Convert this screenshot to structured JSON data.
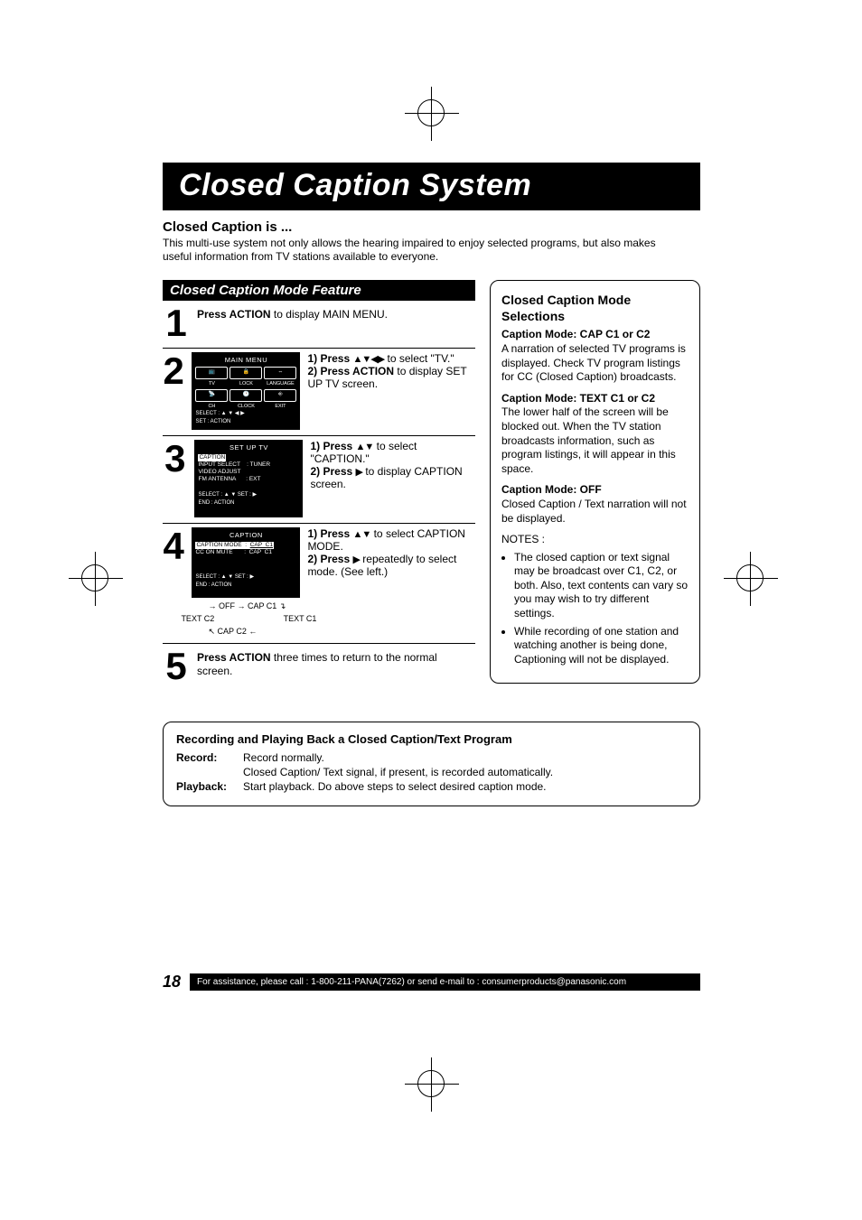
{
  "title": "Closed Caption System",
  "intro": {
    "head": "Closed Caption is ...",
    "text": "This multi-use system not only allows the hearing impaired to enjoy selected programs, but also makes useful information from TV stations available to everyone."
  },
  "feature_head": "Closed Caption Mode Feature",
  "steps": {
    "s1": {
      "num": "1",
      "text_b": "Press ACTION",
      "text": " to display MAIN MENU."
    },
    "s2": {
      "num": "2",
      "osd_title": "MAIN MENU",
      "grid_labels1": [
        "TV",
        "LOCK",
        "LANGUAGE"
      ],
      "grid_labels2": [
        "CH",
        "CLOCK",
        "EXIT"
      ],
      "foot1": "SELECT : ▲ ▼ ◀ ▶",
      "foot2": "SET       : ACTION",
      "i1a": "1)  Press ",
      "i1b": " to select \"TV.\"",
      "i2a": "2)  Press ACTION",
      "i2b": " to display SET UP TV screen."
    },
    "s3": {
      "num": "3",
      "osd_title": "SET UP TV",
      "rows": [
        "<CAPTION>",
        "INPUT SELECT        : TUNER",
        "VIDEO ADJUST",
        "FM ANTENNA            : EXT"
      ],
      "foot1": "SELECT : ▲ ▼          SET : ▶",
      "foot2": "END       : ACTION",
      "i1a": "1)  Press ",
      "i1b": " to select \"CAPTION.\"",
      "i2a": "2)  Press ",
      "i2b": " to display CAPTION screen."
    },
    "s4": {
      "num": "4",
      "osd_title": "CAPTION",
      "rows": [
        "<CAPTION MODE   :   CAP  C1>",
        "CC ON MUTE              :   CAP  C1"
      ],
      "foot1": "SELECT : ▲ ▼          SET : ▶",
      "foot2": "END       : ACTION",
      "cycle": [
        "OFF",
        "CAP C1",
        "TEXT C1",
        "CAP C2",
        "TEXT C2"
      ],
      "i1a": "1)  Press ",
      "i1b": " to select CAPTION MODE.",
      "i2a": "2)  Press ",
      "i2b": " repeatedly to select mode. (See left.)"
    },
    "s5": {
      "num": "5",
      "text_b": "Press ACTION",
      "text": " three times to return to the normal screen."
    }
  },
  "sidebar": {
    "head": "Closed Caption Mode Selections",
    "p1_b": "Caption Mode: CAP C1 or C2",
    "p1": "A narration of selected TV programs is displayed. Check TV program listings for CC (Closed Caption) broadcasts.",
    "p2_b": "Caption Mode: TEXT C1 or C2",
    "p2": "The lower half of the screen will be blocked out. When the TV station broadcasts information, such as program listings, it will appear in this space.",
    "p3_b": "Caption Mode: OFF",
    "p3": "Closed Caption / Text narration will not be displayed.",
    "notes_label": "NOTES :",
    "note1": "The closed caption or text signal may be broadcast over C1, C2, or both. Also, text contents can vary so you may wish to try different settings.",
    "note2": "While recording of one station and watching another is being done, Captioning will not be displayed."
  },
  "bottom": {
    "head": "Recording and Playing Back a Closed Caption/Text Program",
    "rec_label": "Record:",
    "rec1": "Record normally.",
    "rec2": "Closed Caption/ Text signal, if present, is recorded automatically.",
    "pb_label": "Playback:",
    "pb": "Start playback. Do above steps to select desired caption mode."
  },
  "footer": {
    "page": "18",
    "text": "For assistance, please call : 1-800-211-PANA(7262) or send e-mail to : consumerproducts@panasonic.com"
  },
  "icons": {
    "arrows4": "▲▼◀▶",
    "arrows2": "▲▼",
    "arrowR": "▶"
  }
}
